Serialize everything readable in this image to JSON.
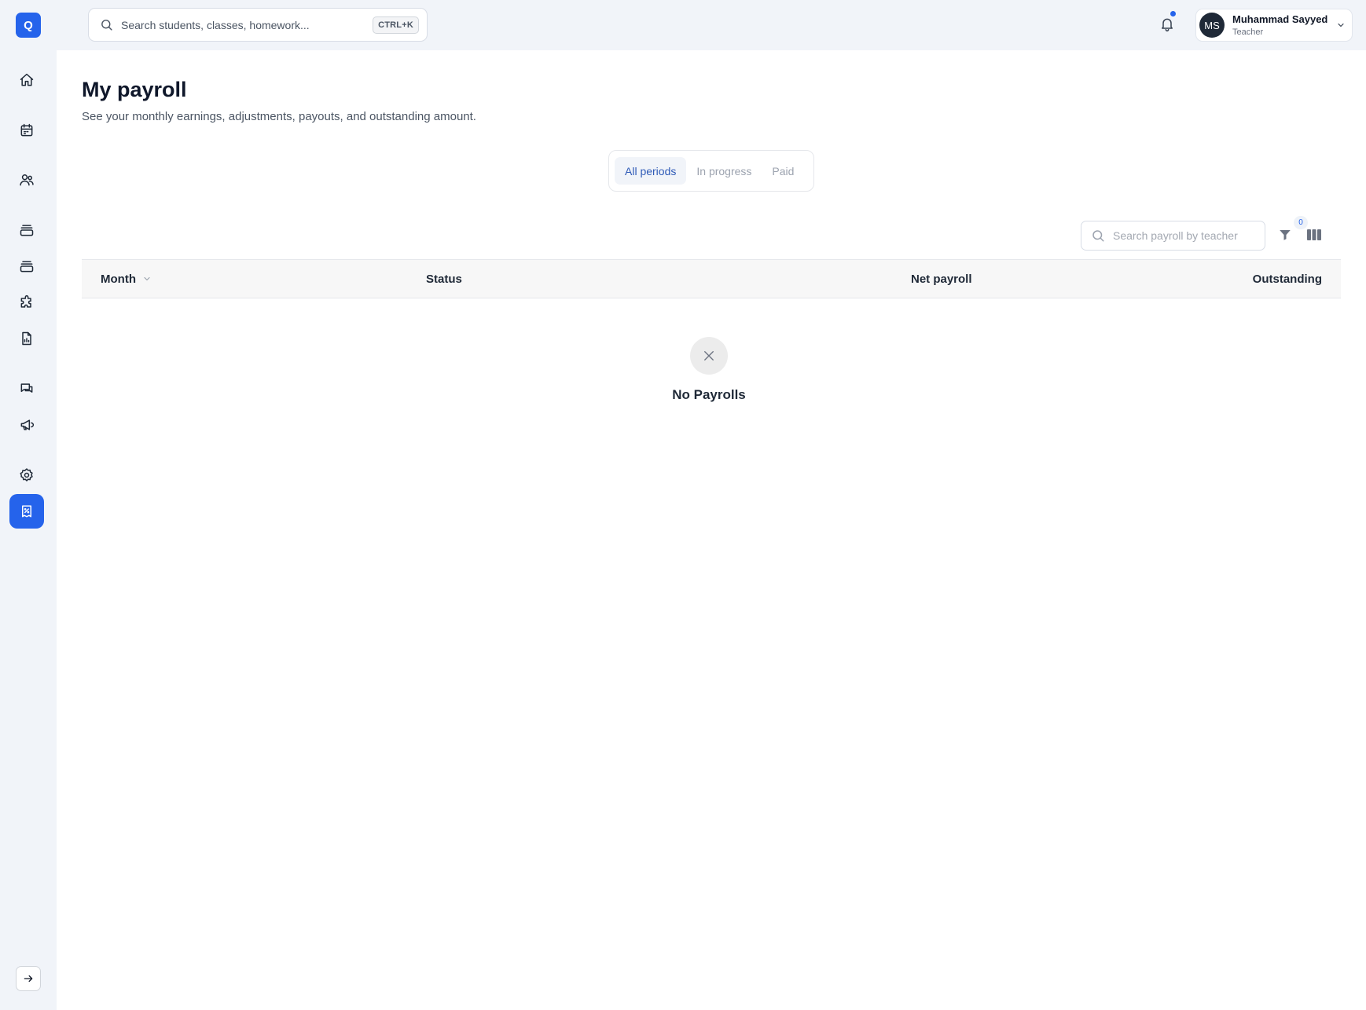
{
  "app": {
    "logo_letter": "Q"
  },
  "topbar": {
    "search_placeholder": "Search students, classes, homework...",
    "search_shortcut": "CTRL+K",
    "user": {
      "initials": "MS",
      "name": "Muhammad Sayyed",
      "role": "Teacher"
    }
  },
  "sidebar": {
    "items": [
      {
        "icon": "home-icon"
      },
      {
        "icon": "calendar-icon"
      },
      {
        "icon": "users-icon"
      },
      {
        "icon": "layers-icon"
      },
      {
        "icon": "layers-icon"
      },
      {
        "icon": "puzzle-icon"
      },
      {
        "icon": "report-icon"
      },
      {
        "icon": "chat-icon"
      },
      {
        "icon": "megaphone-icon"
      },
      {
        "icon": "gear-icon"
      },
      {
        "icon": "receipt-percent-icon",
        "active": true
      }
    ]
  },
  "page": {
    "title": "My payroll",
    "subtitle": "See your monthly earnings, adjustments, payouts, and outstanding amount."
  },
  "tabs": [
    {
      "label": "All periods",
      "active": true
    },
    {
      "label": "In progress",
      "active": false
    },
    {
      "label": "Paid",
      "active": false
    }
  ],
  "toolbar": {
    "search_placeholder": "Search payroll by teacher",
    "filter_count": "0"
  },
  "table": {
    "columns": [
      "Month",
      "Status",
      "Net payroll",
      "Outstanding"
    ],
    "rows": []
  },
  "empty_state": {
    "text": "No Payrolls"
  },
  "colors": {
    "accent": "#2563eb",
    "sidebar_bg": "#f1f4f9"
  }
}
